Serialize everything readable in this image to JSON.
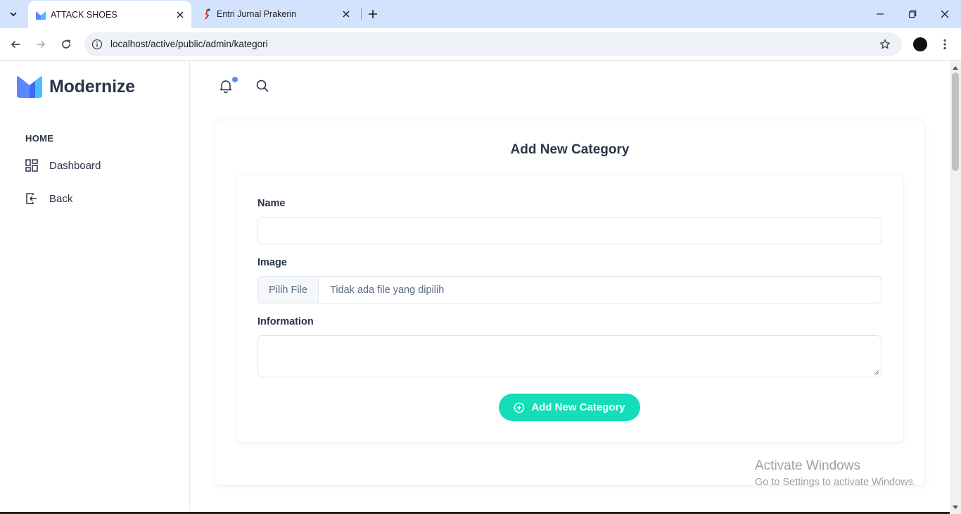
{
  "browser": {
    "tabs": [
      {
        "title": "ATTACK SHOES",
        "active": true
      },
      {
        "title": "Entri Jurnal Prakerin",
        "active": false
      }
    ],
    "url": "localhost/active/public/admin/kategori"
  },
  "sidebar": {
    "brand": "Modernize",
    "section_caption": "HOME",
    "items": [
      {
        "label": "Dashboard",
        "icon": "dashboard-icon"
      },
      {
        "label": "Back",
        "icon": "logout-icon"
      }
    ]
  },
  "form": {
    "title": "Add New Category",
    "name_label": "Name",
    "name_value": "",
    "image_label": "Image",
    "file_button": "Pilih File",
    "file_status": "Tidak ada file yang dipilih",
    "info_label": "Information",
    "info_value": "",
    "submit_label": "Add New Category"
  },
  "watermark": {
    "line1": "Activate Windows",
    "line2": "Go to Settings to activate Windows."
  },
  "colors": {
    "accent": "#5d87ff",
    "success": "#13deb9",
    "text": "#2a3547"
  }
}
